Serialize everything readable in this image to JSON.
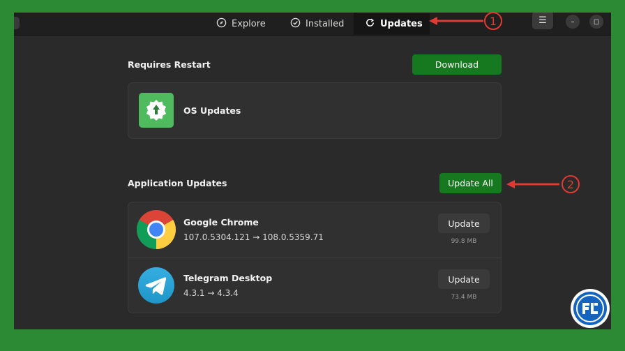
{
  "header": {
    "tabs": [
      {
        "label": "Explore",
        "icon": "compass-icon"
      },
      {
        "label": "Installed",
        "icon": "checkmark-icon"
      },
      {
        "label": "Updates",
        "icon": "refresh-icon",
        "active": true
      }
    ],
    "menu_icon": "☰",
    "minimize_icon": "–",
    "maximize_icon": "◻"
  },
  "restart_section": {
    "title": "Requires Restart",
    "download_label": "Download",
    "item": {
      "name": "OS Updates",
      "icon": "os-update-icon"
    }
  },
  "app_updates": {
    "title": "Application Updates",
    "update_all_label": "Update All",
    "apps": [
      {
        "name": "Google Chrome",
        "version": "107.0.5304.121 → 108.0.5359.71",
        "button": "Update",
        "size": "99.8 MB",
        "icon": "chrome-icon"
      },
      {
        "name": "Telegram Desktop",
        "version": "4.3.1 → 4.3.4",
        "button": "Update",
        "size": "73.4 MB",
        "icon": "telegram-icon"
      }
    ]
  },
  "annotations": {
    "callout_1": "1",
    "callout_2": "2"
  },
  "colors": {
    "background": "#2d8a34",
    "window": "#2a2a2a",
    "accent_green": "#16791f",
    "annotation_red": "#e03a33"
  }
}
